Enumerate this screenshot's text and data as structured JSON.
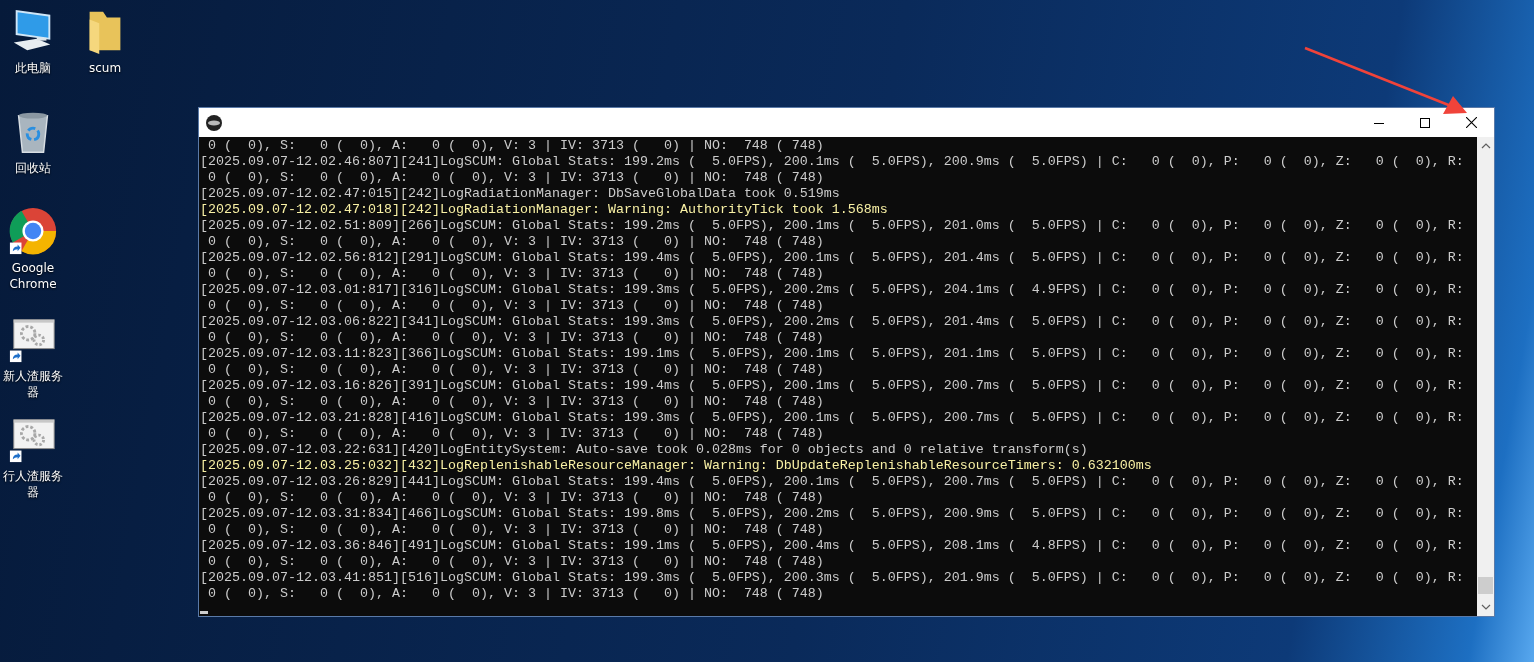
{
  "desktop": {
    "icons": [
      {
        "kind": "computer",
        "label": "此电脑",
        "shortcut": false
      },
      {
        "kind": "folder",
        "label": "scum",
        "shortcut": false
      },
      {
        "kind": "recycle_bin",
        "label": "回收站",
        "shortcut": false
      },
      {
        "kind": "browser",
        "label": "Google Chrome",
        "shortcut": true
      },
      {
        "kind": "program",
        "label": "新人渣服务器",
        "shortcut": true
      },
      {
        "kind": "program",
        "label": "行人渣服务器",
        "shortcut": true
      }
    ]
  },
  "console_window": {
    "lines": [
      {
        "kind": "normal",
        "text": " 0 (  0), S:   0 (  0), A:   0 (  0), V: 3 | IV: 3713 (   0) | NO:  748 ( 748)"
      },
      {
        "kind": "normal",
        "text": "[2025.09.07-12.02.46:807][241]LogSCUM: Global Stats: 199.2ms (  5.0FPS), 200.1ms (  5.0FPS), 200.9ms (  5.0FPS) | C:   0 (  0), P:   0 (  0), Z:   0 (  0), R:"
      },
      {
        "kind": "normal",
        "text": " 0 (  0), S:   0 (  0), A:   0 (  0), V: 3 | IV: 3713 (   0) | NO:  748 ( 748)"
      },
      {
        "kind": "normal",
        "text": "[2025.09.07-12.02.47:015][242]LogRadiationManager: DbSaveGlobalData took 0.519ms"
      },
      {
        "kind": "warning",
        "text": "[2025.09.07-12.02.47:018][242]LogRadiationManager: Warning: AuthorityTick took 1.568ms"
      },
      {
        "kind": "normal",
        "text": "[2025.09.07-12.02.51:809][266]LogSCUM: Global Stats: 199.2ms (  5.0FPS), 200.1ms (  5.0FPS), 201.0ms (  5.0FPS) | C:   0 (  0), P:   0 (  0), Z:   0 (  0), R:"
      },
      {
        "kind": "normal",
        "text": " 0 (  0), S:   0 (  0), A:   0 (  0), V: 3 | IV: 3713 (   0) | NO:  748 ( 748)"
      },
      {
        "kind": "normal",
        "text": "[2025.09.07-12.02.56:812][291]LogSCUM: Global Stats: 199.4ms (  5.0FPS), 200.1ms (  5.0FPS), 201.4ms (  5.0FPS) | C:   0 (  0), P:   0 (  0), Z:   0 (  0), R:"
      },
      {
        "kind": "normal",
        "text": " 0 (  0), S:   0 (  0), A:   0 (  0), V: 3 | IV: 3713 (   0) | NO:  748 ( 748)"
      },
      {
        "kind": "normal",
        "text": "[2025.09.07-12.03.01:817][316]LogSCUM: Global Stats: 199.3ms (  5.0FPS), 200.2ms (  5.0FPS), 204.1ms (  4.9FPS) | C:   0 (  0), P:   0 (  0), Z:   0 (  0), R:"
      },
      {
        "kind": "normal",
        "text": " 0 (  0), S:   0 (  0), A:   0 (  0), V: 3 | IV: 3713 (   0) | NO:  748 ( 748)"
      },
      {
        "kind": "normal",
        "text": "[2025.09.07-12.03.06:822][341]LogSCUM: Global Stats: 199.3ms (  5.0FPS), 200.2ms (  5.0FPS), 201.4ms (  5.0FPS) | C:   0 (  0), P:   0 (  0), Z:   0 (  0), R:"
      },
      {
        "kind": "normal",
        "text": " 0 (  0), S:   0 (  0), A:   0 (  0), V: 3 | IV: 3713 (   0) | NO:  748 ( 748)"
      },
      {
        "kind": "normal",
        "text": "[2025.09.07-12.03.11:823][366]LogSCUM: Global Stats: 199.1ms (  5.0FPS), 200.1ms (  5.0FPS), 201.1ms (  5.0FPS) | C:   0 (  0), P:   0 (  0), Z:   0 (  0), R:"
      },
      {
        "kind": "normal",
        "text": " 0 (  0), S:   0 (  0), A:   0 (  0), V: 3 | IV: 3713 (   0) | NO:  748 ( 748)"
      },
      {
        "kind": "normal",
        "text": "[2025.09.07-12.03.16:826][391]LogSCUM: Global Stats: 199.4ms (  5.0FPS), 200.1ms (  5.0FPS), 200.7ms (  5.0FPS) | C:   0 (  0), P:   0 (  0), Z:   0 (  0), R:"
      },
      {
        "kind": "normal",
        "text": " 0 (  0), S:   0 (  0), A:   0 (  0), V: 3 | IV: 3713 (   0) | NO:  748 ( 748)"
      },
      {
        "kind": "normal",
        "text": "[2025.09.07-12.03.21:828][416]LogSCUM: Global Stats: 199.3ms (  5.0FPS), 200.1ms (  5.0FPS), 200.7ms (  5.0FPS) | C:   0 (  0), P:   0 (  0), Z:   0 (  0), R:"
      },
      {
        "kind": "normal",
        "text": " 0 (  0), S:   0 (  0), A:   0 (  0), V: 3 | IV: 3713 (   0) | NO:  748 ( 748)"
      },
      {
        "kind": "normal",
        "text": "[2025.09.07-12.03.22:631][420]LogEntitySystem: Auto-save took 0.028ms for 0 objects and 0 relative transform(s)"
      },
      {
        "kind": "warning",
        "text": "[2025.09.07-12.03.25:032][432]LogReplenishableResourceManager: Warning: DbUpdateReplenishableResourceTimers: 0.632100ms"
      },
      {
        "kind": "normal",
        "text": "[2025.09.07-12.03.26:829][441]LogSCUM: Global Stats: 199.4ms (  5.0FPS), 200.1ms (  5.0FPS), 200.7ms (  5.0FPS) | C:   0 (  0), P:   0 (  0), Z:   0 (  0), R:"
      },
      {
        "kind": "normal",
        "text": " 0 (  0), S:   0 (  0), A:   0 (  0), V: 3 | IV: 3713 (   0) | NO:  748 ( 748)"
      },
      {
        "kind": "normal",
        "text": "[2025.09.07-12.03.31:834][466]LogSCUM: Global Stats: 199.8ms (  5.0FPS), 200.2ms (  5.0FPS), 200.9ms (  5.0FPS) | C:   0 (  0), P:   0 (  0), Z:   0 (  0), R:"
      },
      {
        "kind": "normal",
        "text": " 0 (  0), S:   0 (  0), A:   0 (  0), V: 3 | IV: 3713 (   0) | NO:  748 ( 748)"
      },
      {
        "kind": "normal",
        "text": "[2025.09.07-12.03.36:846][491]LogSCUM: Global Stats: 199.1ms (  5.0FPS), 200.4ms (  5.0FPS), 208.1ms (  4.8FPS) | C:   0 (  0), P:   0 (  0), Z:   0 (  0), R:"
      },
      {
        "kind": "normal",
        "text": " 0 (  0), S:   0 (  0), A:   0 (  0), V: 3 | IV: 3713 (   0) | NO:  748 ( 748)"
      },
      {
        "kind": "normal",
        "text": "[2025.09.07-12.03.41:851][516]LogSCUM: Global Stats: 199.3ms (  5.0FPS), 200.3ms (  5.0FPS), 201.9ms (  5.0FPS) | C:   0 (  0), P:   0 (  0), Z:   0 (  0), R:"
      },
      {
        "kind": "normal",
        "text": " 0 (  0), S:   0 (  0), A:   0 (  0), V: 3 | IV: 3713 (   0) | NO:  748 ( 748)"
      }
    ]
  }
}
